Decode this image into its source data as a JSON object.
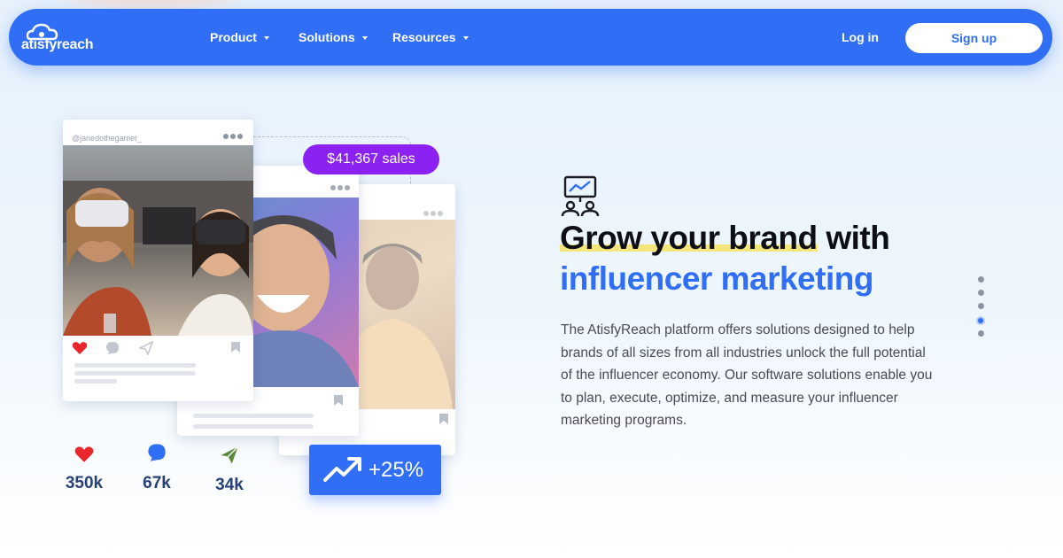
{
  "brand": {
    "logo_text": "atisfyreach"
  },
  "nav": {
    "product_label": "Product",
    "solutions_label": "Solutions",
    "resources_label": "Resources",
    "login_label": "Log in",
    "signup_label": "Sign up"
  },
  "post_card": {
    "handle": "@janedothegamer_"
  },
  "badges": {
    "sales": "$41,367 sales",
    "growth": "+25%"
  },
  "stats": [
    {
      "icon": "heart-icon",
      "value": "350k"
    },
    {
      "icon": "comment-icon",
      "value": "67k"
    },
    {
      "icon": "send-icon",
      "value": "34k"
    }
  ],
  "hero": {
    "headline_highlight": "Grow your brand",
    "headline_rest": " with",
    "headline_line2": "influencer marketing",
    "body": "The AtisfyReach platform offers solutions designed to help brands of all sizes from all industries unlock the full potential of the influencer economy. Our software solutions enable you to plan, execute, optimize, and measure your influencer marketing programs."
  },
  "pager": {
    "count": 5,
    "active_index": 3
  },
  "colors": {
    "primary": "#2f6ef5",
    "purple": "#8b22f2",
    "like_red": "#e8262c",
    "headline_dark": "#0e0e16",
    "highlight_yellow": "#f5e67c"
  }
}
